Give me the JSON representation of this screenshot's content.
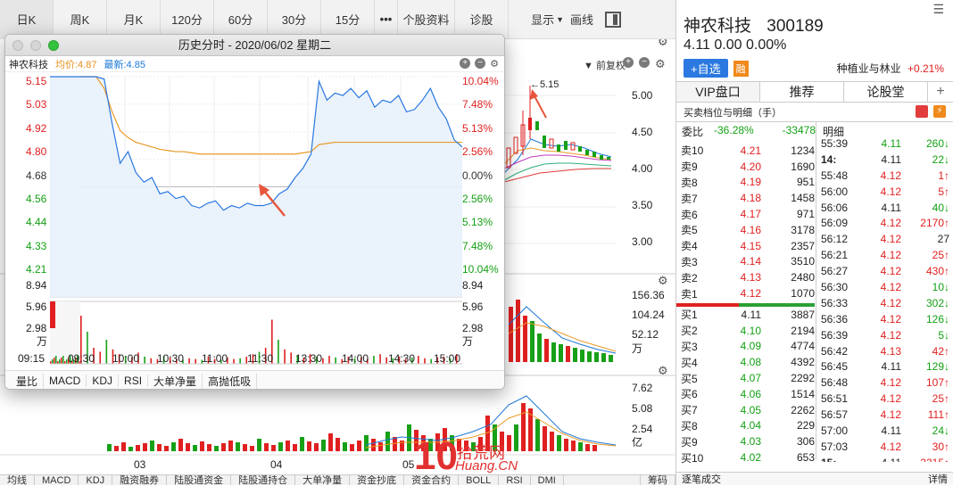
{
  "toolbar": {
    "tabs": [
      "日K",
      "周K",
      "月K",
      "120分",
      "60分",
      "30分",
      "15分"
    ],
    "more": "•••",
    "f10": "个股资料",
    "diag": "诊股",
    "show": "显示",
    "draw": "画线"
  },
  "main": {
    "fuquan": "前复权",
    "y_labels": [
      "5.00",
      "4.50",
      "4.00",
      "3.50",
      "3.00"
    ],
    "peak_label": "←5.15",
    "vol_labels": [
      "156.36",
      "104.24",
      "52.12",
      "万"
    ],
    "amt_labels": [
      "7.62",
      "5.08",
      "2.54",
      "亿"
    ],
    "months": [
      "03",
      "04",
      "05"
    ],
    "bottom_tabs": [
      "均线",
      "MACD",
      "KDJ",
      "融资融券",
      "陆股通资金",
      "陆股通持仓",
      "大单净量",
      "资金抄底",
      "资金合约",
      "BOLL",
      "RSI",
      "DMI"
    ],
    "right_tab": "筹码",
    "watermark_brand": "拾荒网",
    "watermark_url": "Huang.CN",
    "watermark_num": "10"
  },
  "popup": {
    "title": "历史分时 - 2020/06/02 星期二",
    "stock_name": "神农科技",
    "avg_label": "均价:4.87",
    "last_label": "最新:4.85",
    "price_levels": [
      "5.15",
      "5.03",
      "4.92",
      "4.80",
      "4.68",
      "4.56",
      "4.44",
      "4.33",
      "4.21"
    ],
    "pct_levels": [
      "10.04%",
      "7.48%",
      "5.13%",
      "2.56%",
      "0.00%",
      "2.56%",
      "5.13%",
      "7.48%",
      "10.04%"
    ],
    "vol_levels": [
      "8.94",
      "5.96",
      "2.98",
      "万"
    ],
    "vol_levels_right": [
      "8.94",
      "5.96",
      "2.98",
      "万"
    ],
    "times": [
      "09:15",
      "09:30",
      "10:00",
      "10:30",
      "11:00",
      "11:30",
      "13:30",
      "14:00",
      "14:30",
      "15:00"
    ],
    "indicator_tabs": [
      "量比",
      "MACD",
      "KDJ",
      "RSI",
      "大单净量",
      "高抛低吸"
    ],
    "chart_data": {
      "type": "line",
      "prev_close": 4.68,
      "ylim": [
        4.21,
        5.15
      ],
      "series": [
        {
          "name": "最新",
          "values": [
            5.15,
            5.15,
            5.15,
            5.14,
            4.95,
            4.78,
            4.83,
            4.74,
            4.7,
            4.72,
            4.65,
            4.66,
            4.63,
            4.64,
            4.6,
            4.59,
            4.61,
            4.62,
            4.58,
            4.6,
            4.59,
            4.61,
            4.6,
            4.6,
            4.61,
            4.65,
            4.67,
            4.72,
            4.76,
            4.82,
            5.13,
            5.05,
            5.08,
            5.07,
            5.1,
            5.06,
            5.09,
            5.02,
            5.05,
            5.04,
            5.07,
            5.0,
            5.01,
            5.05,
            5.1,
            5.02,
            4.97,
            4.88,
            4.85
          ]
        },
        {
          "name": "均价",
          "values": [
            5.15,
            5.15,
            5.15,
            5.1,
            5.0,
            4.92,
            4.89,
            4.87,
            4.86,
            4.85,
            4.84,
            4.835,
            4.83,
            4.83,
            4.825,
            4.82,
            4.82,
            4.82,
            4.82,
            4.82,
            4.82,
            4.82,
            4.82,
            4.82,
            4.82,
            4.82,
            4.82,
            4.82,
            4.825,
            4.83,
            4.86,
            4.865,
            4.87,
            4.87,
            4.87,
            4.87,
            4.87,
            4.87,
            4.87,
            4.87,
            4.87,
            4.87,
            4.87,
            4.87,
            4.87,
            4.87,
            4.87,
            4.87,
            4.87
          ]
        }
      ]
    }
  },
  "quote": {
    "name": "神农科技",
    "code": "300189",
    "price_line": "4.11 0.00 0.00%",
    "add_fav": "+自选",
    "rong": "融",
    "industry": "种植业与林业",
    "industry_pct": "+0.21%",
    "tabs": [
      "VIP盘口",
      "推荐",
      "论股堂"
    ],
    "plus": "+",
    "depth_title": "买卖档位与明细（手）",
    "weibi_label": "委比",
    "weibi_pct": "-36.28%",
    "weibi_val": "-33478",
    "detail_label": "明细",
    "sells": [
      {
        "label": "卖10",
        "price": "4.21",
        "vol": "1234"
      },
      {
        "label": "卖9",
        "price": "4.20",
        "vol": "1690"
      },
      {
        "label": "卖8",
        "price": "4.19",
        "vol": "951"
      },
      {
        "label": "卖7",
        "price": "4.18",
        "vol": "1458"
      },
      {
        "label": "卖6",
        "price": "4.17",
        "vol": "971"
      },
      {
        "label": "卖5",
        "price": "4.16",
        "vol": "3178"
      },
      {
        "label": "卖4",
        "price": "4.15",
        "vol": "2357"
      },
      {
        "label": "卖3",
        "price": "4.14",
        "vol": "3510"
      },
      {
        "label": "卖2",
        "price": "4.13",
        "vol": "2480"
      },
      {
        "label": "卖1",
        "price": "4.12",
        "vol": "1070"
      }
    ],
    "buys": [
      {
        "label": "买1",
        "price": "4.11",
        "vol": "3887"
      },
      {
        "label": "买2",
        "price": "4.10",
        "vol": "2194"
      },
      {
        "label": "买3",
        "price": "4.09",
        "vol": "4774"
      },
      {
        "label": "买4",
        "price": "4.08",
        "vol": "4392"
      },
      {
        "label": "买5",
        "price": "4.07",
        "vol": "2292"
      },
      {
        "label": "买6",
        "price": "4.06",
        "vol": "1514"
      },
      {
        "label": "买7",
        "price": "4.05",
        "vol": "2262"
      },
      {
        "label": "买8",
        "price": "4.04",
        "vol": "229"
      },
      {
        "label": "买9",
        "price": "4.03",
        "vol": "306"
      },
      {
        "label": "买10",
        "price": "4.02",
        "vol": "653"
      }
    ],
    "ticks": [
      {
        "time": "55:39",
        "price": "4.11",
        "vol": "260↓",
        "pc": "green",
        "vc": "green"
      },
      {
        "time": "14:",
        "price": "4.11",
        "vol": "22↓",
        "pc": "",
        "vc": "green",
        "bold": true
      },
      {
        "time": "55:48",
        "price": "4.12",
        "vol": "1↑",
        "pc": "red",
        "vc": "red"
      },
      {
        "time": "56:00",
        "price": "4.12",
        "vol": "5↑",
        "pc": "red",
        "vc": "red"
      },
      {
        "time": "56:06",
        "price": "4.11",
        "vol": "40↓",
        "pc": "",
        "vc": "green"
      },
      {
        "time": "56:09",
        "price": "4.12",
        "vol": "2170↑",
        "pc": "red",
        "vc": "red"
      },
      {
        "time": "56:12",
        "price": "4.12",
        "vol": "27",
        "pc": "red",
        "vc": ""
      },
      {
        "time": "56:21",
        "price": "4.12",
        "vol": "25↑",
        "pc": "red",
        "vc": "red"
      },
      {
        "time": "56:27",
        "price": "4.12",
        "vol": "430↑",
        "pc": "red",
        "vc": "red"
      },
      {
        "time": "56:30",
        "price": "4.12",
        "vol": "10↓",
        "pc": "red",
        "vc": "green"
      },
      {
        "time": "56:33",
        "price": "4.12",
        "vol": "302↓",
        "pc": "red",
        "vc": "green"
      },
      {
        "time": "56:36",
        "price": "4.12",
        "vol": "126↓",
        "pc": "red",
        "vc": "green"
      },
      {
        "time": "56:39",
        "price": "4.12",
        "vol": "5↓",
        "pc": "red",
        "vc": "green"
      },
      {
        "time": "56:42",
        "price": "4.13",
        "vol": "42↑",
        "pc": "red",
        "vc": "red"
      },
      {
        "time": "56:45",
        "price": "4.11",
        "vol": "129↓",
        "pc": "",
        "vc": "green"
      },
      {
        "time": "56:48",
        "price": "4.12",
        "vol": "107↑",
        "pc": "red",
        "vc": "red"
      },
      {
        "time": "56:51",
        "price": "4.12",
        "vol": "25↑",
        "pc": "red",
        "vc": "red"
      },
      {
        "time": "56:57",
        "price": "4.12",
        "vol": "111↑",
        "pc": "red",
        "vc": "red"
      },
      {
        "time": "57:00",
        "price": "4.11",
        "vol": "24↓",
        "pc": "",
        "vc": "green"
      },
      {
        "time": "57:03",
        "price": "4.12",
        "vol": "30↑",
        "pc": "red",
        "vc": "red"
      },
      {
        "time": "15:",
        "price": "4.11",
        "vol": "2215↑",
        "pc": "",
        "vc": "red",
        "bold": true
      }
    ],
    "footer_left": "逐笔成交",
    "footer_right": "详情"
  }
}
